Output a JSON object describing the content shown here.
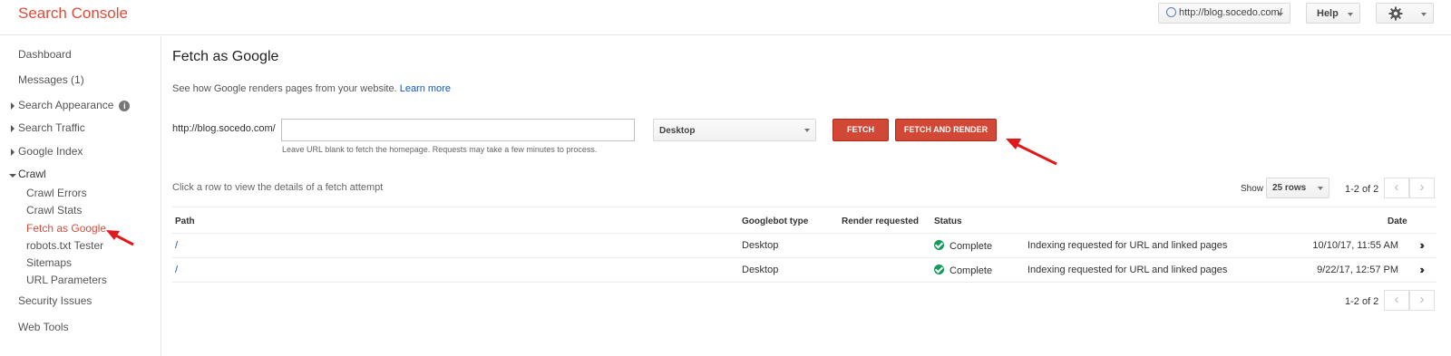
{
  "app": {
    "title": "Search Console"
  },
  "header": {
    "site": "http://blog.socedo.com/",
    "help_label": "Help"
  },
  "sidebar": {
    "items": [
      {
        "label": "Dashboard"
      },
      {
        "label": "Messages (1)"
      },
      {
        "label": "Search Appearance"
      },
      {
        "label": "Search Traffic"
      },
      {
        "label": "Google Index"
      },
      {
        "label": "Crawl"
      },
      {
        "label": "Crawl Errors"
      },
      {
        "label": "Crawl Stats"
      },
      {
        "label": "Fetch as Google"
      },
      {
        "label": "robots.txt Tester"
      },
      {
        "label": "Sitemaps"
      },
      {
        "label": "URL Parameters"
      },
      {
        "label": "Security Issues"
      },
      {
        "label": "Web Tools"
      }
    ]
  },
  "main": {
    "title": "Fetch as Google",
    "subtitle": "See how Google renders pages from your website.",
    "learn_more": "Learn more",
    "url_prefix": "http://blog.socedo.com/",
    "url_value": "",
    "hint": "Leave URL blank to fetch the homepage. Requests may take a few minutes to process.",
    "device": "Desktop",
    "fetch_label": "FETCH",
    "fetch_render_label": "FETCH AND RENDER",
    "row_hint": "Click a row to view the details of a fetch attempt",
    "show_label": "Show",
    "rows_per_page": "25 rows",
    "pager_text": "1-2 of 2",
    "columns": {
      "path": "Path",
      "googlebot": "Googlebot type",
      "render": "Render requested",
      "status": "Status",
      "date": "Date"
    },
    "rows": [
      {
        "path": "/",
        "googlebot": "Desktop",
        "render": "",
        "status": "Complete",
        "detail": "Indexing requested for URL and linked pages",
        "date": "10/10/17, 11:55 AM"
      },
      {
        "path": "/",
        "googlebot": "Desktop",
        "render": "",
        "status": "Complete",
        "detail": "Indexing requested for URL and linked pages",
        "date": "9/22/17, 12:57 PM"
      }
    ]
  },
  "colors": {
    "brand": "#dd4b39",
    "link": "#1155cc",
    "button": "#d14836",
    "complete": "#0f9d58",
    "annotation": "#e0191a"
  },
  "icons": [
    "globe-icon",
    "gear-icon",
    "info-icon",
    "check-circle-icon",
    "chevron-left-icon",
    "chevron-right-icon",
    "double-chevron-right-icon",
    "annotation-arrow"
  ]
}
